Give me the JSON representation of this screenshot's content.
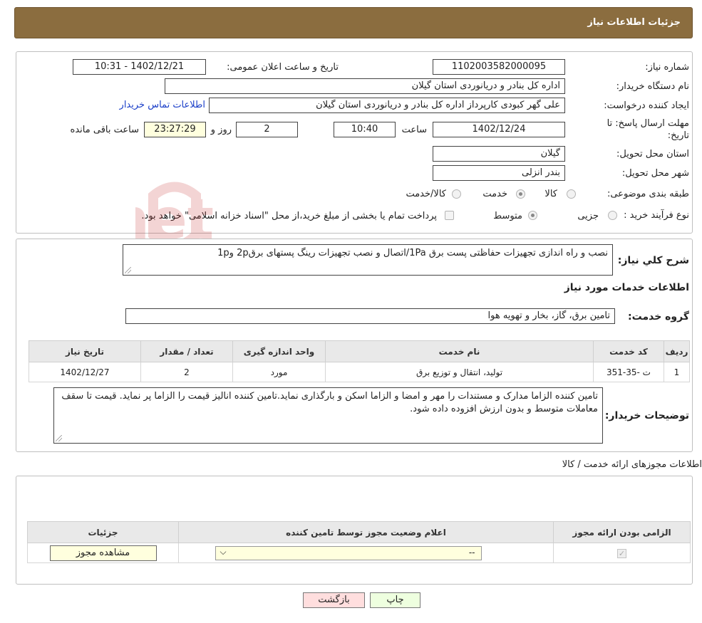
{
  "header": {
    "title": "جزئیات اطلاعات نیاز"
  },
  "form": {
    "need_number": {
      "label": "شماره نیاز:",
      "value": "1102003582000095"
    },
    "announce_datetime": {
      "label": "تاریخ و ساعت اعلان عمومی:",
      "value": "1402/12/21 - 10:31"
    },
    "buyer_org": {
      "label": "نام دستگاه خریدار:",
      "value": "اداره کل بنادر و دریانوردی استان گیلان"
    },
    "requester": {
      "label": "ایجاد کننده درخواست:",
      "value": "علی  گهر کبودی کارپرداز اداره کل بنادر و دریانوردی استان گیلان",
      "contact_link": "اطلاعات تماس خریدار"
    },
    "deadline": {
      "label": "مهلت ارسال پاسخ: تا تاریخ:",
      "date": "1402/12/24",
      "time_label": "ساعت",
      "time": "10:40",
      "days": "2",
      "days_label": "روز و",
      "remaining": "23:27:29",
      "remaining_label": "ساعت باقی مانده"
    },
    "province": {
      "label": "استان محل تحویل:",
      "value": "گیلان"
    },
    "city": {
      "label": "شهر محل تحویل:",
      "value": "بندر انزلی"
    },
    "category": {
      "label": "طبقه بندی موضوعی:",
      "options": [
        {
          "label": "کالا",
          "checked": false
        },
        {
          "label": "خدمت",
          "checked": true
        },
        {
          "label": "کالا/خدمت",
          "checked": false
        }
      ]
    },
    "purchase_type": {
      "label": "نوع فرآیند خرید :",
      "options": [
        {
          "label": "جزیی",
          "checked": false
        },
        {
          "label": "متوسط",
          "checked": true
        }
      ],
      "payment_note": "پرداخت تمام یا بخشی از مبلغ خرید،از محل \"اسناد خزانه اسلامی\" خواهد بود."
    }
  },
  "summary": {
    "label": "شرح کلي نياز:",
    "value": "نصب و راه اندازی تجهیزات حفاظتی پست برق 1Pa/اتصال و نصب تجهیزات رینگ پستهای برق2p و1p"
  },
  "services": {
    "title": "اطلاعات خدمات مورد نياز",
    "group_label": "گروه خدمت:",
    "group_value": "تامین برق، گاز، بخار و تهویه هوا",
    "table": {
      "headers": [
        "ردیف",
        "کد خدمت",
        "نام خدمت",
        "واحد اندازه گیری",
        "تعداد / مقدار",
        "تاریخ نیاز"
      ],
      "rows": [
        [
          "1",
          "ت -35-351",
          "تولید، انتقال و توزیع برق",
          "مورد",
          "2",
          "1402/12/27"
        ]
      ]
    }
  },
  "buyer_notes": {
    "label": "توضیحات خریدار:",
    "value": "تامین کننده الزاما مدارک و مستندات را مهر و امضا و الزاما اسکن و بارگذاری نماید.تامین کننده انالیز قیمت را الزاما پر نماید. قیمت تا سقف معاملات متوسط و بدون ارزش افزوده داده شود."
  },
  "licenses": {
    "title": "اطلاعات مجوزهای ارائه خدمت / کالا",
    "headers": [
      "الزامی بودن ارائه مجوز",
      "اعلام وضعیت مجوز توسط تامین کننده",
      "جزئیات"
    ],
    "row": {
      "required_checked": true,
      "status_value": "--",
      "details_button": "مشاهده مجوز"
    }
  },
  "footer": {
    "print_label": "چاپ",
    "back_label": "بازگشت"
  },
  "watermark": {
    "text": "AriaTender.net"
  }
}
